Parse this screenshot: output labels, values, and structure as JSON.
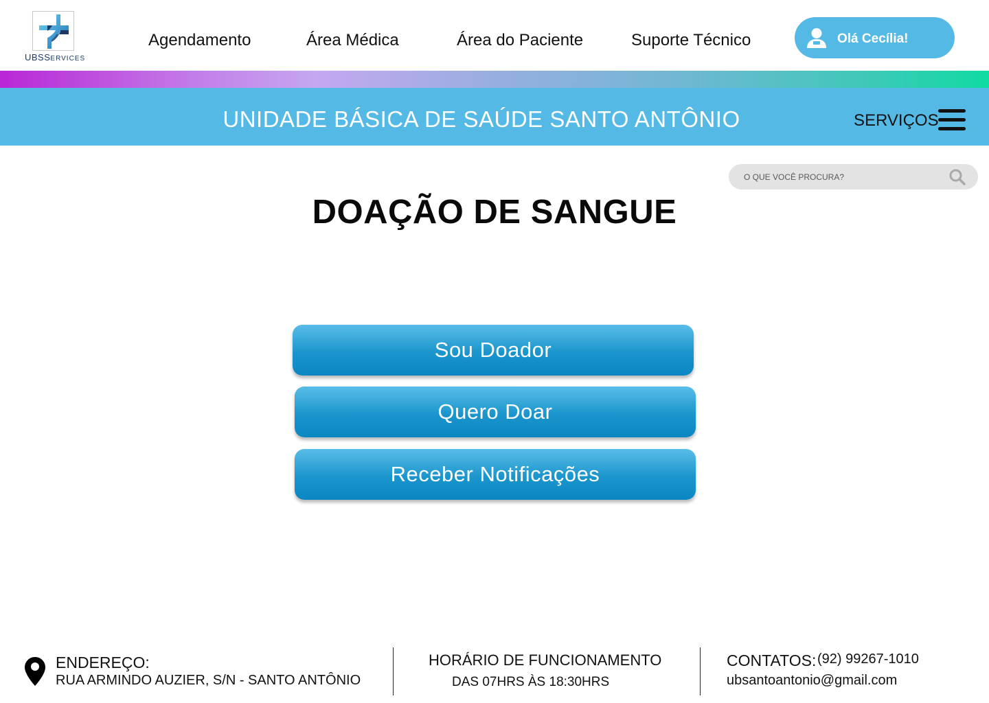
{
  "header": {
    "logo_text_main": "UBS",
    "logo_text_sub": "ERVICES",
    "logo_text_cap": "S",
    "nav": [
      {
        "label": "Agendamento"
      },
      {
        "label": "Área Médica"
      },
      {
        "label": "Área do Paciente"
      },
      {
        "label": "Suporte Técnico"
      }
    ],
    "user_greeting": "Olá Cecília!"
  },
  "banner": {
    "title": "UNIDADE BÁSICA DE SAÚDE SANTO ANTÔNIO",
    "services_label": "SERVIÇOS"
  },
  "search": {
    "placeholder": "O QUE VOCÊ PROCURA?"
  },
  "main": {
    "title": "DOAÇÃO DE SANGUE",
    "buttons": [
      {
        "label": "Sou Doador"
      },
      {
        "label": "Quero Doar"
      },
      {
        "label": "Receber Notificações"
      }
    ]
  },
  "footer": {
    "address_label": "ENDEREÇO:",
    "address_value": "RUA ARMINDO AUZIER, S/N - SANTO ANTÔNIO",
    "hours_label": "HORÁRIO DE FUNCIONAMENTO",
    "hours_value": "DAS 07HRS ÀS 18:30HRS",
    "contacts_label": "CONTATOS:",
    "phone": "(92) 99267-1010",
    "email": "ubsantoantonio@gmail.com"
  },
  "colors": {
    "primary_blue": "#55b9e5",
    "button_blue": "#1b95cc",
    "logo_navy": "#1d3b63"
  },
  "icons": [
    "logo-cross-icon",
    "user-icon",
    "search-icon",
    "hamburger-menu-icon",
    "location-pin-icon"
  ]
}
